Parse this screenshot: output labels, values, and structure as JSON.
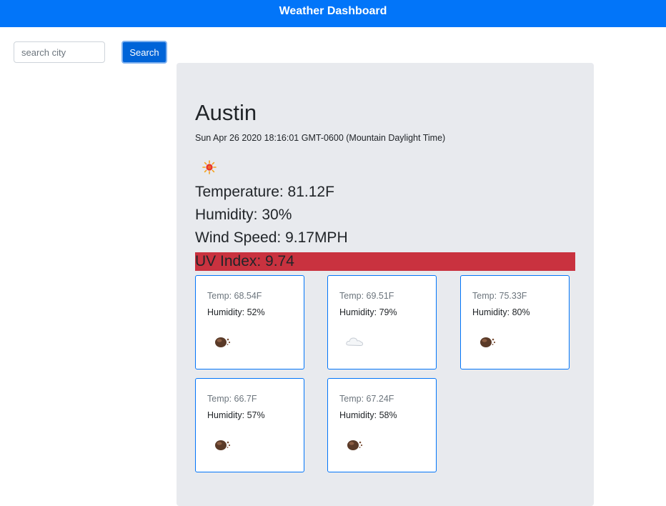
{
  "header": {
    "title": "Weather Dashboard"
  },
  "search": {
    "placeholder": "search city",
    "value": "",
    "button_label": "Search"
  },
  "current": {
    "city": "Austin",
    "datetime": "Sun Apr 26 2020 18:16:01 GMT-0600 (Mountain Daylight Time)",
    "icon": "sun-icon",
    "temperature": "Temperature: 81.12F",
    "humidity": "Humidity: 30%",
    "wind_speed": "Wind Speed: 9.17MPH",
    "uv_index": "UV Index: 9.74",
    "uv_color": "#c9323f"
  },
  "forecast": [
    {
      "temp": "Temp: 68.54F",
      "humidity": "Humidity: 52%",
      "icon": "dust-icon"
    },
    {
      "temp": "Temp: 69.51F",
      "humidity": "Humidity: 79%",
      "icon": "cloud-icon"
    },
    {
      "temp": "Temp: 75.33F",
      "humidity": "Humidity: 80%",
      "icon": "dust-icon"
    },
    {
      "temp": "Temp: 66.7F",
      "humidity": "Humidity: 57%",
      "icon": "dust-icon"
    },
    {
      "temp": "Temp: 67.24F",
      "humidity": "Humidity: 58%",
      "icon": "dust-icon"
    }
  ],
  "colors": {
    "header_bg": "#0275f9",
    "button_bg": "#0064d8",
    "panel_bg": "#e8eaee",
    "card_border": "#0275f9"
  }
}
